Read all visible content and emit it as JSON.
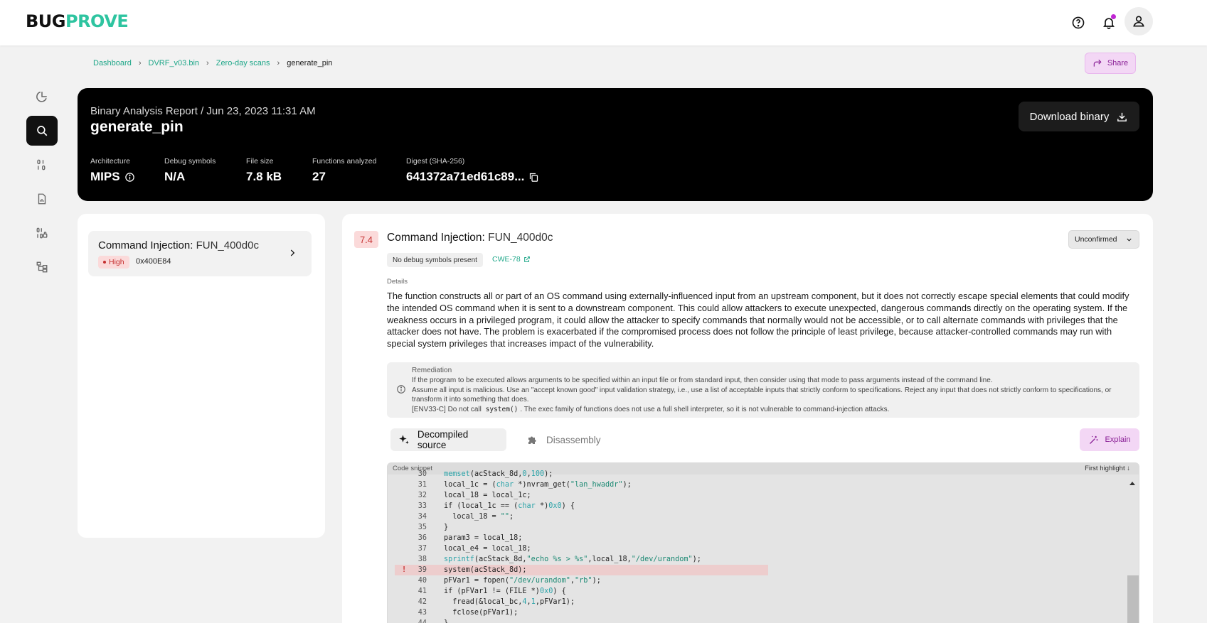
{
  "app": {
    "logo_part1": "BUG",
    "logo_part2": "PROVE",
    "brand_color": "#2ec4a0",
    "accent_color": "#c026d3"
  },
  "topbar": {
    "icons": [
      "help-icon",
      "bell-icon",
      "user-icon"
    ]
  },
  "sidebar": {
    "items": [
      {
        "name": "dashboard",
        "icon": "pie-chart-icon"
      },
      {
        "name": "analysis",
        "icon": "magnifier-icon",
        "active": true
      },
      {
        "name": "binary",
        "icon": "binary-icon"
      },
      {
        "name": "reports",
        "icon": "report-icon"
      },
      {
        "name": "secure-binary",
        "icon": "binary-lock-icon"
      },
      {
        "name": "tree",
        "icon": "tree-icon"
      }
    ]
  },
  "breadcrumb": {
    "items": [
      "Dashboard",
      "DVRF_v03.bin",
      "Zero-day scans"
    ],
    "current": "generate_pin"
  },
  "share": {
    "label": "Share"
  },
  "header": {
    "report_title": "Binary Analysis Report / Jun 23, 2023 11:31 AM",
    "name": "generate_pin",
    "download_label": "Download binary",
    "meta": [
      {
        "label": "Architecture",
        "value": "MIPS"
      },
      {
        "label": "Debug symbols",
        "value": "N/A"
      },
      {
        "label": "File size",
        "value": "7.8 kB"
      },
      {
        "label": "Functions analyzed",
        "value": "27"
      },
      {
        "label": "Digest (SHA-256)",
        "value": "641372a71ed61c89..."
      }
    ]
  },
  "findings": [
    {
      "type": "Command Injection:",
      "function": "FUN_400d0c",
      "severity": "High",
      "address": "0x400E84"
    }
  ],
  "detail": {
    "score": "7.4",
    "type": "Command Injection:",
    "function": "FUN_400d0c",
    "status": "Unconfirmed",
    "tag_debug": "No debug symbols present",
    "cwe": "CWE-78",
    "details_label": "Details",
    "details_text": "The function constructs all or part of an OS command using externally-influenced input from an upstream component, but it does not correctly escape special elements that could modify the intended OS command when it is sent to a downstream component. This could allow attackers to execute unexpected, dangerous commands directly on the operating system. If the weakness occurs in a privileged program, it could allow the attacker to specify commands that normally would not be accessible, or to call alternate commands with privileges that the attacker does not have. The problem is exacerbated if the compromised process does not follow the principle of least privilege, because attacker-controlled commands may run with special system privileges that increases impact of the vulnerability.",
    "remediation_label": "Remediation",
    "remediation_line1": "If the program to be executed allows arguments to be specified within an input file or from standard input, then consider using that mode to pass arguments instead of the command line.",
    "remediation_line2": "Assume all input is malicious. Use an \"accept known good\" input validation strategy, i.e., use a list of acceptable inputs that strictly conform to specifications. Reject any input that does not strictly conform to specifications, or transform it into something that does.",
    "remediation_line3_pre": "[ENV33-C] Do not call",
    "remediation_line3_code": "system()",
    "remediation_line3_post": ". The exec family of functions does not use a full shell interpreter, so it is not vulnerable to command-injection attacks.",
    "tabs": [
      "Decompiled source",
      "Disassembly"
    ],
    "explain_label": "Explain",
    "code_label": "Code snippet",
    "first_highlight": "First highlight ↓",
    "highlight_marker": "!"
  }
}
